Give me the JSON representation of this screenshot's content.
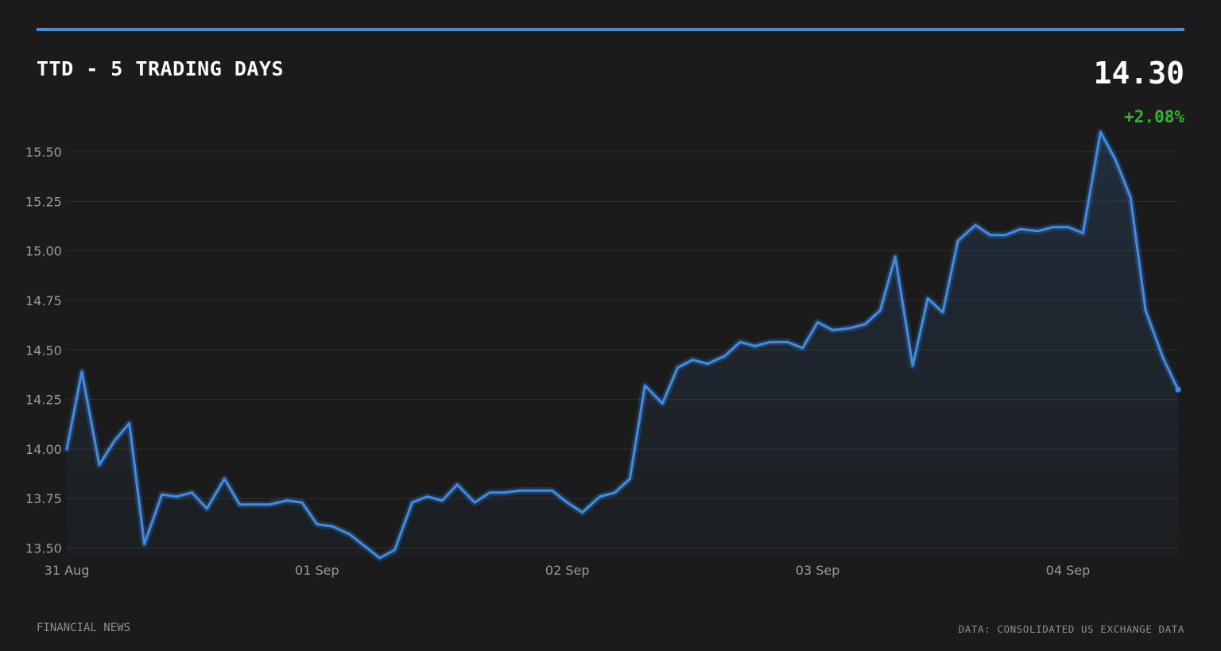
{
  "header": {
    "title": "TTD - 5 TRADING DAYS",
    "price": "14.30",
    "change": "+2.08%"
  },
  "footer": {
    "source_left": "FINANCIAL NEWS",
    "source_right": "DATA: CONSOLIDATED US EXCHANGE DATA"
  },
  "colors": {
    "background": "#1b1b1b",
    "accent": "#3d8be6",
    "positive": "#35b52f",
    "grid": "#2e2e2e",
    "tick_text": "#9a9a9a"
  },
  "chart_data": {
    "type": "area",
    "title": "TTD - 5 TRADING DAYS",
    "xlabel": "",
    "ylabel": "",
    "x_ticks": [
      "31 Aug",
      "01 Sep",
      "02 Sep",
      "03 Sep",
      "04 Sep"
    ],
    "y_ticks": [
      13.5,
      13.75,
      14.0,
      14.25,
      14.5,
      14.75,
      15.0,
      15.25,
      15.5
    ],
    "ylim": [
      13.4,
      15.6
    ],
    "xlim": [
      0,
      4.44
    ],
    "grid": true,
    "legend": "none",
    "series": [
      {
        "x": [
          0.0,
          0.06,
          0.13,
          0.19,
          0.25,
          0.31,
          0.38,
          0.44,
          0.5,
          0.56,
          0.63,
          0.69,
          0.75,
          0.81,
          0.88,
          0.94,
          1.0,
          1.06,
          1.13,
          1.19,
          1.25,
          1.31,
          1.38,
          1.44,
          1.5,
          1.56,
          1.63,
          1.69,
          1.75,
          1.81,
          1.88,
          1.94,
          2.0,
          2.06,
          2.13,
          2.19,
          2.25,
          2.31,
          2.38,
          2.44,
          2.5,
          2.56,
          2.63,
          2.69,
          2.75,
          2.81,
          2.88,
          2.94,
          3.0,
          3.06,
          3.13,
          3.19,
          3.25,
          3.31,
          3.38,
          3.44,
          3.5,
          3.56,
          3.63,
          3.69,
          3.75,
          3.81,
          3.88,
          3.94,
          4.0,
          4.06,
          4.13,
          4.19,
          4.25,
          4.31,
          4.38,
          4.44
        ],
        "y": [
          14.0,
          14.39,
          13.92,
          14.04,
          14.13,
          13.52,
          13.77,
          13.76,
          13.78,
          13.7,
          13.85,
          13.72,
          13.72,
          13.72,
          13.74,
          13.73,
          13.62,
          13.61,
          13.57,
          13.51,
          13.45,
          13.49,
          13.73,
          13.76,
          13.74,
          13.82,
          13.73,
          13.78,
          13.78,
          13.79,
          13.79,
          13.79,
          13.73,
          13.68,
          13.76,
          13.78,
          13.85,
          14.32,
          14.23,
          14.41,
          14.45,
          14.43,
          14.47,
          14.54,
          14.52,
          14.54,
          14.54,
          14.51,
          14.64,
          14.6,
          14.61,
          14.63,
          14.7,
          14.97,
          14.42,
          14.76,
          14.69,
          15.05,
          15.13,
          15.08,
          15.08,
          15.11,
          15.1,
          15.12,
          15.12,
          15.09,
          15.6,
          15.46,
          15.27,
          14.7,
          14.46,
          14.3
        ]
      }
    ]
  }
}
